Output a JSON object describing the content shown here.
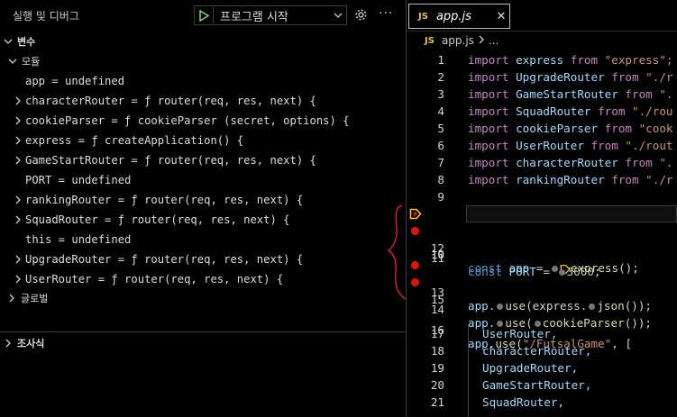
{
  "debug": {
    "title": "실행 및 디버그",
    "launch_config": "프로그램 시작",
    "sections": {
      "variables": "변수",
      "modules": "모듈",
      "globals": "글로벌",
      "watch": "조사식"
    },
    "variables": [
      {
        "text": "app = undefined",
        "expandable": false
      },
      {
        "text": "characterRouter = ƒ router(req, res, next) {",
        "expandable": true
      },
      {
        "text": "cookieParser = ƒ cookieParser (secret, options) {",
        "expandable": true
      },
      {
        "text": "express = ƒ createApplication() {",
        "expandable": true
      },
      {
        "text": "GameStartRouter = ƒ router(req, res, next) {",
        "expandable": true
      },
      {
        "text": "PORT = undefined",
        "expandable": false
      },
      {
        "text": "rankingRouter = ƒ router(req, res, next) {",
        "expandable": true
      },
      {
        "text": "SquadRouter = ƒ router(req, res, next) {",
        "expandable": true
      },
      {
        "text": "this = undefined",
        "expandable": false
      },
      {
        "text": "UpgradeRouter = ƒ router(req, res, next) {",
        "expandable": true
      },
      {
        "text": "UserRouter = ƒ router(req, res, next) {",
        "expandable": true
      }
    ]
  },
  "editor": {
    "tab_icon": "JS",
    "tab_name": "app.js",
    "breadcrumb_file": "app.js",
    "breadcrumb_tail": "...",
    "line_numbers": [
      "1",
      "2",
      "3",
      "4",
      "5",
      "6",
      "7",
      "8",
      "9",
      "10",
      "11",
      "12",
      "13",
      "14",
      "15",
      "16",
      "17",
      "18",
      "19",
      "20",
      "21"
    ],
    "code": {
      "l1": [
        "import",
        " express ",
        "from",
        " \"express\";"
      ],
      "l2": [
        "import",
        " UpgradeRouter ",
        "from",
        " \"./r"
      ],
      "l3": [
        "import",
        " GameStartRouter ",
        "from",
        " \"."
      ],
      "l4": [
        "import",
        " SquadRouter ",
        "from",
        " \"./rou"
      ],
      "l5": [
        "import",
        " cookieParser ",
        "from",
        " \"cook"
      ],
      "l6": [
        "import",
        " UserRouter ",
        "from",
        " \"./rout"
      ],
      "l7": [
        "import",
        " characterRouter ",
        "from",
        " \"."
      ],
      "l8": [
        "import",
        " rankingRouter ",
        "from",
        " \"./r"
      ],
      "l10": [
        "const",
        " app ",
        "= ",
        "express",
        "();"
      ],
      "l11": [
        "const",
        " PORT ",
        "= ",
        "3000",
        ";"
      ],
      "l13": [
        "app",
        ".",
        "use",
        "(express.",
        "json",
        "());"
      ],
      "l14": [
        "app",
        ".",
        "use",
        "(",
        "cookieParser",
        "());"
      ],
      "l16": [
        "app",
        ".",
        "use",
        "(",
        "\"/FutsalGame\"",
        ", ["
      ],
      "l17": "UserRouter,",
      "l18": "characterRouter,",
      "l19": "UpgradeRouter,",
      "l20": "GameStartRouter,",
      "l21": "SquadRouter,"
    }
  }
}
